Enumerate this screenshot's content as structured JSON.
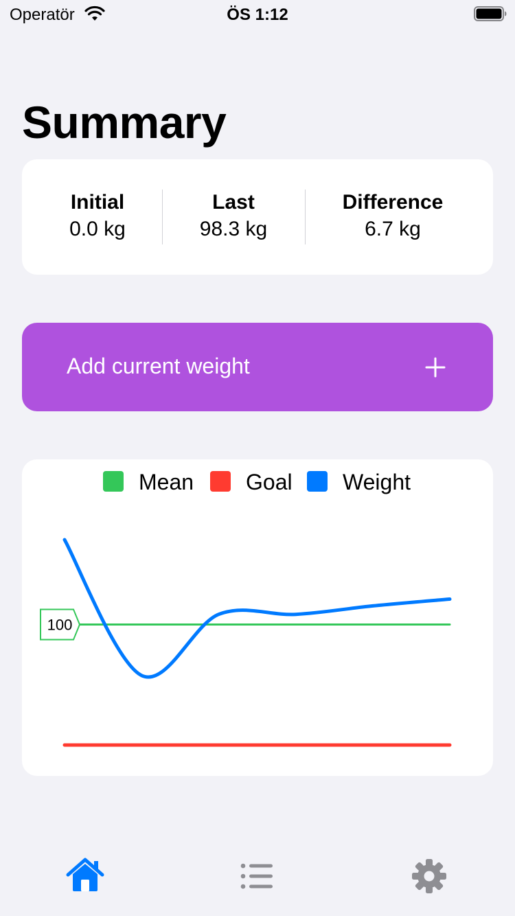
{
  "status_bar": {
    "carrier": "Operatör",
    "time": "ÖS 1:12",
    "icons": [
      "wifi-icon",
      "battery-icon"
    ]
  },
  "page": {
    "title": "Summary"
  },
  "summary": {
    "initial": {
      "label": "Initial",
      "value": "0.0 kg"
    },
    "last": {
      "label": "Last",
      "value": "98.3 kg"
    },
    "difference": {
      "label": "Difference",
      "value": "6.7 kg"
    }
  },
  "add_button": {
    "label": "Add current weight",
    "icon": "plus-icon"
  },
  "chart_data": {
    "type": "line",
    "legend": [
      {
        "name": "Mean",
        "color": "#34c759"
      },
      {
        "name": "Goal",
        "color": "#ff3b30"
      },
      {
        "name": "Weight",
        "color": "#007aff"
      }
    ],
    "legend_position": "top-center",
    "grid": false,
    "x": [
      0,
      1,
      2,
      3,
      4,
      5
    ],
    "series": [
      {
        "name": "Weight",
        "color": "#007aff",
        "values": [
          105,
          97,
          100.6,
          100.6,
          101.1,
          101.5
        ]
      },
      {
        "name": "Mean",
        "color": "#34c759",
        "values": [
          100,
          100,
          100,
          100,
          100,
          100
        ]
      },
      {
        "name": "Goal",
        "color": "#ff3b30",
        "values": [
          92.9,
          92.9,
          92.9,
          92.9,
          92.9,
          92.9
        ]
      }
    ],
    "ylim": [
      92.9,
      105
    ],
    "annotations": [
      {
        "series": "Mean",
        "text": "100"
      }
    ]
  },
  "tab_bar": {
    "tabs": [
      {
        "name": "home",
        "icon": "house-icon",
        "active": true,
        "color": "#007aff"
      },
      {
        "name": "list",
        "icon": "list-icon",
        "active": false,
        "color": "#8e8e93"
      },
      {
        "name": "settings",
        "icon": "gear-icon",
        "active": false,
        "color": "#8e8e93"
      }
    ]
  },
  "colors": {
    "background": "#f2f2f7",
    "card": "#ffffff",
    "accent": "#af52de",
    "active_tab": "#007aff",
    "inactive_tab": "#8e8e93"
  }
}
